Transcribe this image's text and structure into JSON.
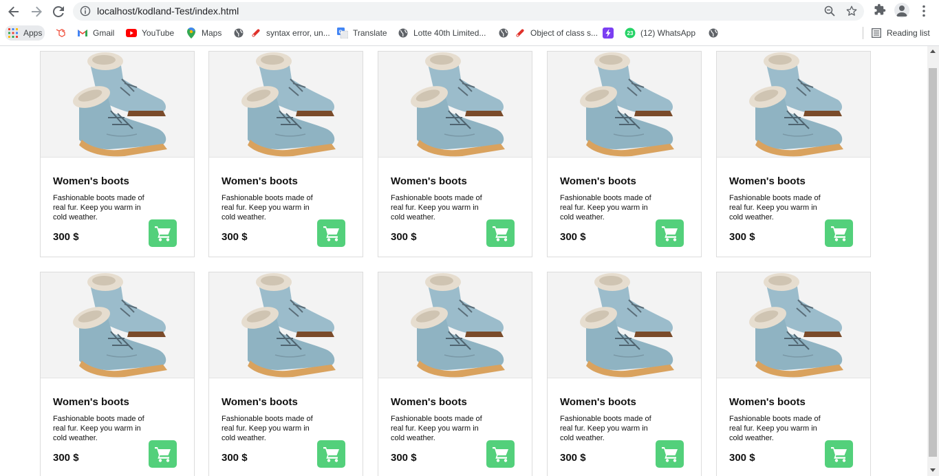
{
  "browser": {
    "url": "localhost/kodland-Test/index.html",
    "reading_list_label": "Reading list"
  },
  "bookmarks": [
    {
      "label": "Apps",
      "icon": "apps-grid-icon"
    },
    {
      "label": "",
      "icon": "laravel-icon"
    },
    {
      "label": "Gmail",
      "icon": "gmail-icon"
    },
    {
      "label": "YouTube",
      "icon": "youtube-icon"
    },
    {
      "label": "Maps",
      "icon": "maps-icon"
    },
    {
      "label": "",
      "icon": "globe-icon"
    },
    {
      "label": "syntax error, un...",
      "icon": "ruby-icon"
    },
    {
      "label": "Translate",
      "icon": "translate-icon"
    },
    {
      "label": "Lotte 40th Limited...",
      "icon": "globe-icon"
    },
    {
      "label": "",
      "icon": "globe-icon"
    },
    {
      "label": "Object of class s...",
      "icon": "ruby-icon"
    },
    {
      "label": "",
      "icon": "lightning-icon"
    },
    {
      "label": "(12) WhatsApp",
      "icon": "whatsapp-icon"
    },
    {
      "label": "",
      "icon": "globe-icon"
    }
  ],
  "whatsapp_badge": "23",
  "products": [
    {
      "title": "Women's boots",
      "description": "Fashionable boots made of real fur. Keep you warm in cold weather.",
      "price": "300 $"
    },
    {
      "title": "Women's boots",
      "description": "Fashionable boots made of real fur. Keep you warm in cold weather.",
      "price": "300 $"
    },
    {
      "title": "Women's boots",
      "description": "Fashionable boots made of real fur. Keep you warm in cold weather.",
      "price": "300 $"
    },
    {
      "title": "Women's boots",
      "description": "Fashionable boots made of real fur. Keep you warm in cold weather.",
      "price": "300 $"
    },
    {
      "title": "Women's boots",
      "description": "Fashionable boots made of real fur. Keep you warm in cold weather.",
      "price": "300 $"
    },
    {
      "title": "Women's boots",
      "description": "Fashionable boots made of real fur. Keep you warm in cold weather.",
      "price": "300 $"
    },
    {
      "title": "Women's boots",
      "description": "Fashionable boots made of real fur. Keep you warm in cold weather.",
      "price": "300 $"
    },
    {
      "title": "Women's boots",
      "description": "Fashionable boots made of real fur. Keep you warm in cold weather.",
      "price": "300 $"
    },
    {
      "title": "Women's boots",
      "description": "Fashionable boots made of real fur. Keep you warm in cold weather.",
      "price": "300 $"
    },
    {
      "title": "Women's boots",
      "description": "Fashionable boots made of real fur. Keep you warm in cold weather.",
      "price": "300 $"
    }
  ],
  "colors": {
    "cart_button": "#53d07b",
    "boot_leather": "#8fb3c2",
    "boot_sole": "#d9a25e",
    "fur": "#e6ddcf"
  }
}
